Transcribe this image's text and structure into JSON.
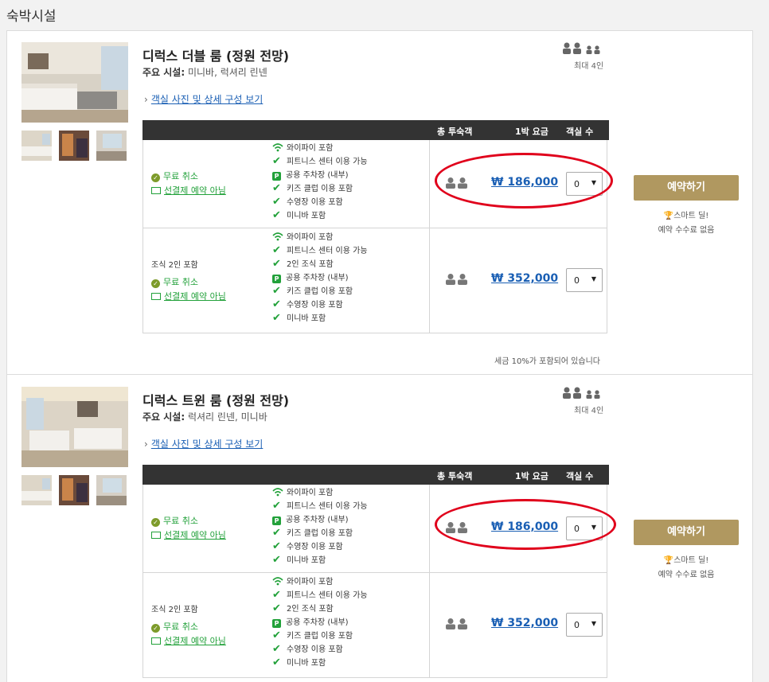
{
  "page": {
    "title": "숙박시설"
  },
  "rooms": [
    {
      "title": "디럭스 더블 룸 (정원 전망)",
      "facilities_label": "주요 시설:",
      "facilities_value": "미니바, 럭셔리 린넨",
      "detail_link": "객실 사진 및 상세 구성 보기",
      "max_occupancy": "최대 4인",
      "table_headers": {
        "guests": "총 투숙객",
        "price": "1박 요금",
        "rooms": "객실 수"
      },
      "rates": [
        {
          "breakfast": "",
          "cancel": "무료 취소",
          "prepay": "선결제 예약 아님",
          "amenities": [
            "와이파이 포함",
            "피트니스 센터 이용 가능",
            "공용 주차장 (내부)",
            "키즈 클럽 이용 포함",
            "수영장 이용 포함",
            "미니바 포함"
          ],
          "price": "₩ 186,000",
          "room_count": "0",
          "book_button": "예약하기",
          "smart_deal": "스마트 딜!",
          "no_fee": "예약 수수료 없음"
        },
        {
          "breakfast": "조식 2인 포함",
          "cancel": "무료 취소",
          "prepay": "선결제 예약 아님",
          "amenities": [
            "와이파이 포함",
            "피트니스 센터 이용 가능",
            "2인 조식 포함",
            "공용 주차장 (내부)",
            "키즈 클럽 이용 포함",
            "수영장 이용 포함",
            "미니바 포함"
          ],
          "price": "₩ 352,000",
          "room_count": "0"
        }
      ],
      "tax_note": "세금 10%가 포함되어 있습니다"
    },
    {
      "title": "디럭스 트윈 룸 (정원 전망)",
      "facilities_label": "주요 시설:",
      "facilities_value": "럭셔리 린넨, 미니바",
      "detail_link": "객실 사진 및 상세 구성 보기",
      "max_occupancy": "최대 4인",
      "table_headers": {
        "guests": "총 투숙객",
        "price": "1박 요금",
        "rooms": "객실 수"
      },
      "rates": [
        {
          "breakfast": "",
          "cancel": "무료 취소",
          "prepay": "선결제 예약 아님",
          "amenities": [
            "와이파이 포함",
            "피트니스 센터 이용 가능",
            "공용 주차장 (내부)",
            "키즈 클럽 이용 포함",
            "수영장 이용 포함",
            "미니바 포함"
          ],
          "price": "₩ 186,000",
          "room_count": "0",
          "book_button": "예약하기",
          "smart_deal": "스마트 딜!",
          "no_fee": "예약 수수료 없음"
        },
        {
          "breakfast": "조식 2인 포함",
          "cancel": "무료 취소",
          "prepay": "선결제 예약 아님",
          "amenities": [
            "와이파이 포함",
            "피트니스 센터 이용 가능",
            "2인 조식 포함",
            "공용 주차장 (내부)",
            "키즈 클럽 이용 포함",
            "수영장 이용 포함",
            "미니바 포함"
          ],
          "price": "₩ 352,000",
          "room_count": "0"
        }
      ]
    }
  ],
  "icons": {
    "wifi": "wifi-icon",
    "check": "check-icon",
    "parking": "parking-icon",
    "person": "person-icon",
    "trophy": "trophy-icon",
    "card": "card-icon"
  },
  "colors": {
    "accent_gold": "#b09860",
    "link_blue": "#1a5fb4",
    "green": "#22a13a",
    "highlight_red": "#e0001b"
  }
}
